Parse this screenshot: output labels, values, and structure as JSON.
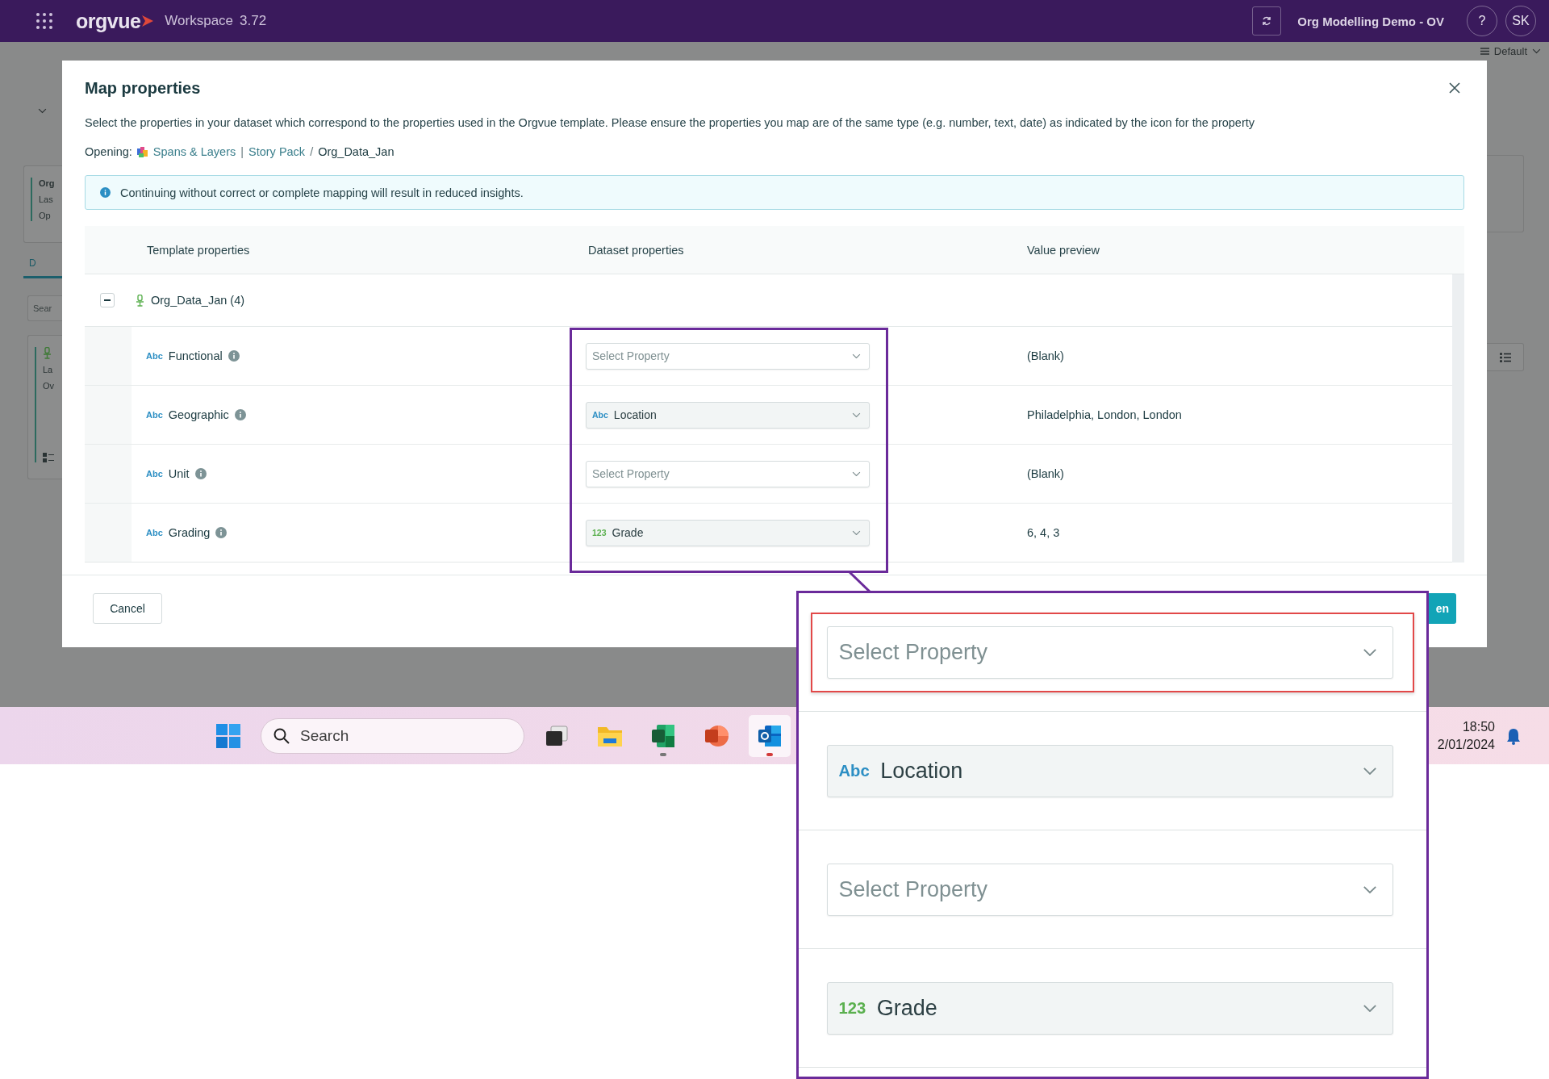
{
  "top_bar": {
    "product": "orgvue",
    "workspace": "Workspace",
    "version": "3.72",
    "project": "Org Modelling Demo - OV",
    "help": "?",
    "avatar": "SK"
  },
  "background": {
    "view_selector": "Default",
    "card_lines": [
      "Org",
      "Las",
      "Op"
    ],
    "tab": "D",
    "search": {
      "placeholder": "Sear"
    },
    "item_lines": [
      "La",
      "Ov"
    ]
  },
  "dialog": {
    "title": "Map properties",
    "description": "Select the properties in your dataset which correspond to the properties used in the Orgvue template. Please ensure the properties you map are of the same type (e.g. number, text, date) as indicated by the icon for the property",
    "opening_label": "Opening:",
    "breadcrumb": [
      {
        "kind": "link",
        "text": "Spans & Layers"
      },
      {
        "kind": "separator",
        "text": "|"
      },
      {
        "kind": "link",
        "text": "Story Pack"
      },
      {
        "kind": "separator",
        "text": "/"
      },
      {
        "kind": "current",
        "text": "Org_Data_Jan"
      }
    ],
    "notice": "Continuing without correct or complete mapping will result in reduced insights.",
    "columns": [
      "Template properties",
      "Dataset properties",
      "Value preview"
    ],
    "group": {
      "name": "Org_Data_Jan (4)",
      "expanded": true
    },
    "rows": [
      {
        "badge": {
          "label": "Abc",
          "kind": "text"
        },
        "name": "Functional",
        "mapping": {
          "placeholder": "Select Property"
        },
        "preview": "(Blank)"
      },
      {
        "badge": {
          "label": "Abc",
          "kind": "text"
        },
        "name": "Geographic",
        "mapping": {
          "badge": {
            "label": "Abc",
            "kind": "text"
          },
          "value": "Location"
        },
        "preview": "Philadelphia, London, London"
      },
      {
        "badge": {
          "label": "Abc",
          "kind": "text"
        },
        "name": "Unit",
        "mapping": {
          "placeholder": "Select Property"
        },
        "preview": "(Blank)"
      },
      {
        "badge": {
          "label": "Abc",
          "kind": "text"
        },
        "name": "Grading",
        "mapping": {
          "badge": {
            "label": "123",
            "kind": "number"
          },
          "value": "Grade"
        },
        "preview": "6, 4, 3"
      }
    ],
    "cancel": "Cancel",
    "primary": "en"
  },
  "callout": {
    "rows": [
      {
        "highlighted": true,
        "mapping": {
          "placeholder": "Select Property"
        }
      },
      {
        "highlighted": false,
        "mapping": {
          "badge": {
            "label": "Abc",
            "kind": "text"
          },
          "value": "Location"
        }
      },
      {
        "highlighted": false,
        "mapping": {
          "placeholder": "Select Property"
        }
      },
      {
        "highlighted": false,
        "mapping": {
          "badge": {
            "label": "123",
            "kind": "number"
          },
          "value": "Grade"
        }
      }
    ]
  },
  "taskbar": {
    "search": {
      "placeholder": "Search"
    },
    "apps": [
      {
        "kind": "task-view",
        "running": false,
        "selected": false
      },
      {
        "kind": "files",
        "running": false,
        "selected": false
      },
      {
        "kind": "spreadsheet",
        "running": true,
        "selected": false
      },
      {
        "kind": "slides",
        "running": false,
        "selected": false
      },
      {
        "kind": "mail",
        "running": true,
        "selected": true
      }
    ],
    "time": "18:50",
    "date": "2/01/2024"
  }
}
